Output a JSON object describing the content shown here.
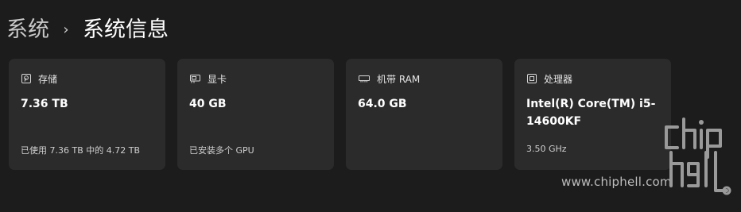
{
  "breadcrumb": {
    "parent": "系统",
    "separator": "›",
    "current": "系统信息"
  },
  "cards": [
    {
      "icon": "storage-icon",
      "label": "存储",
      "value": "7.36 TB",
      "sub": "已使用 7.36 TB 中的 4.72 TB"
    },
    {
      "icon": "graphics-card-icon",
      "label": "显卡",
      "value": "40 GB",
      "sub": "已安装多个 GPU"
    },
    {
      "icon": "ram-icon",
      "label": "机带 RAM",
      "value": "64.0 GB",
      "sub": ""
    },
    {
      "icon": "processor-icon",
      "label": "处理器",
      "value": "Intel(R) Core(TM) i5-14600KF",
      "sub": "3.50 GHz"
    }
  ],
  "watermark": {
    "text": "www.chiphell.com",
    "logo": "chip hell"
  },
  "colors": {
    "background": "#1c1c1c",
    "card": "#2b2b2b",
    "text": "#ffffff",
    "muted": "#cfcfcf"
  }
}
